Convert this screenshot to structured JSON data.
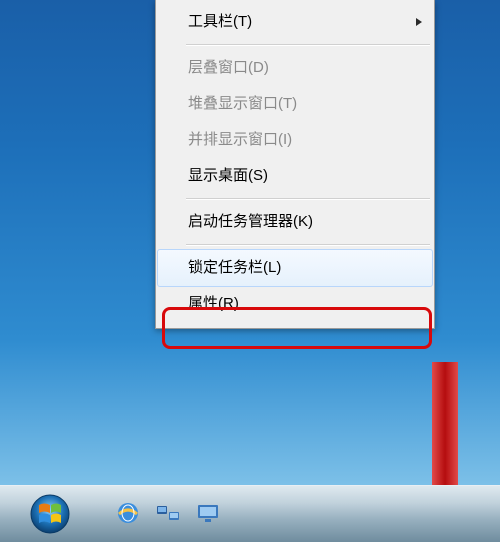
{
  "menu": {
    "toolbar": "工具栏(T)",
    "cascade": "层叠窗口(D)",
    "stacked": "堆叠显示窗口(T)",
    "sidebyside": "并排显示窗口(I)",
    "showdesktop": "显示桌面(S)",
    "taskmanager": "启动任务管理器(K)",
    "locktaskbar": "锁定任务栏(L)",
    "properties": "属性(R)"
  },
  "taskbar": {
    "start": "Start",
    "ie": "Internet Explorer",
    "item1": "Network",
    "item2": "Desktop"
  }
}
